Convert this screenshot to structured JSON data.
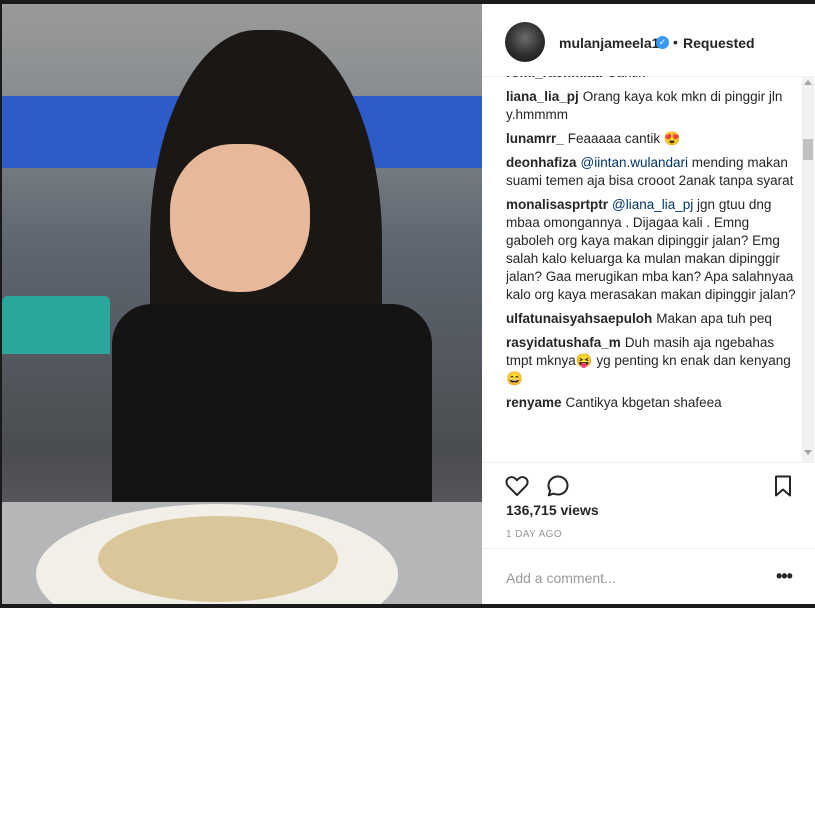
{
  "header": {
    "username": "mulanjameela1",
    "separator": "•",
    "follow_status": "Requested"
  },
  "comments": [
    {
      "user": "romi_rachmiati",
      "pre": "",
      "mention": "",
      "text": "Cantik"
    },
    {
      "user": "liana_lia_pj",
      "pre": "",
      "mention": "",
      "text": "Orang kaya kok mkn di pinggir jln y.hmmmm"
    },
    {
      "user": "lunamrr_",
      "pre": "",
      "mention": "",
      "text": "Feaaaaa cantik 😍"
    },
    {
      "user": "deonhafiza",
      "pre": "",
      "mention": "@iintan.wulandari",
      "text": " mending makan suami temen aja bisa crooot 2anak tanpa syarat"
    },
    {
      "user": "monalisasprtptr",
      "pre": "",
      "mention": "@liana_lia_pj",
      "text": " jgn gtuu dng mbaa omongannya . Dijagaa kali . Emng gaboleh org kaya makan dipinggir jalan? Emg salah kalo keluarga ka mulan makan dipinggir jalan? Gaa merugikan mba kan? Apa salahnyaa kalo org kaya merasakan makan dipinggir jalan?"
    },
    {
      "user": "ulfatunaisyahsaepuloh",
      "pre": "",
      "mention": "",
      "text": "Makan apa tuh peq"
    },
    {
      "user": "rasyidatushafa_m",
      "pre": "",
      "mention": "",
      "text": "Duh masih aja ngebahas tmpt mknya😝 yg penting kn enak dan kenyang 😄"
    },
    {
      "user": "renyame",
      "pre": "",
      "mention": "",
      "text": "Cantikya kbgetan shafeea"
    }
  ],
  "stats": {
    "views": "136,715 views",
    "time_ago": "1 DAY AGO"
  },
  "add_comment": {
    "placeholder": "Add a comment...",
    "more": "•••"
  },
  "icons": {
    "like": "heart-icon",
    "comment": "comment-bubble-icon",
    "save": "bookmark-icon",
    "verified": "verified-badge-icon"
  },
  "colors": {
    "verified": "#3897f0",
    "mention": "#003569",
    "muted": "#999999",
    "text": "#262626"
  }
}
